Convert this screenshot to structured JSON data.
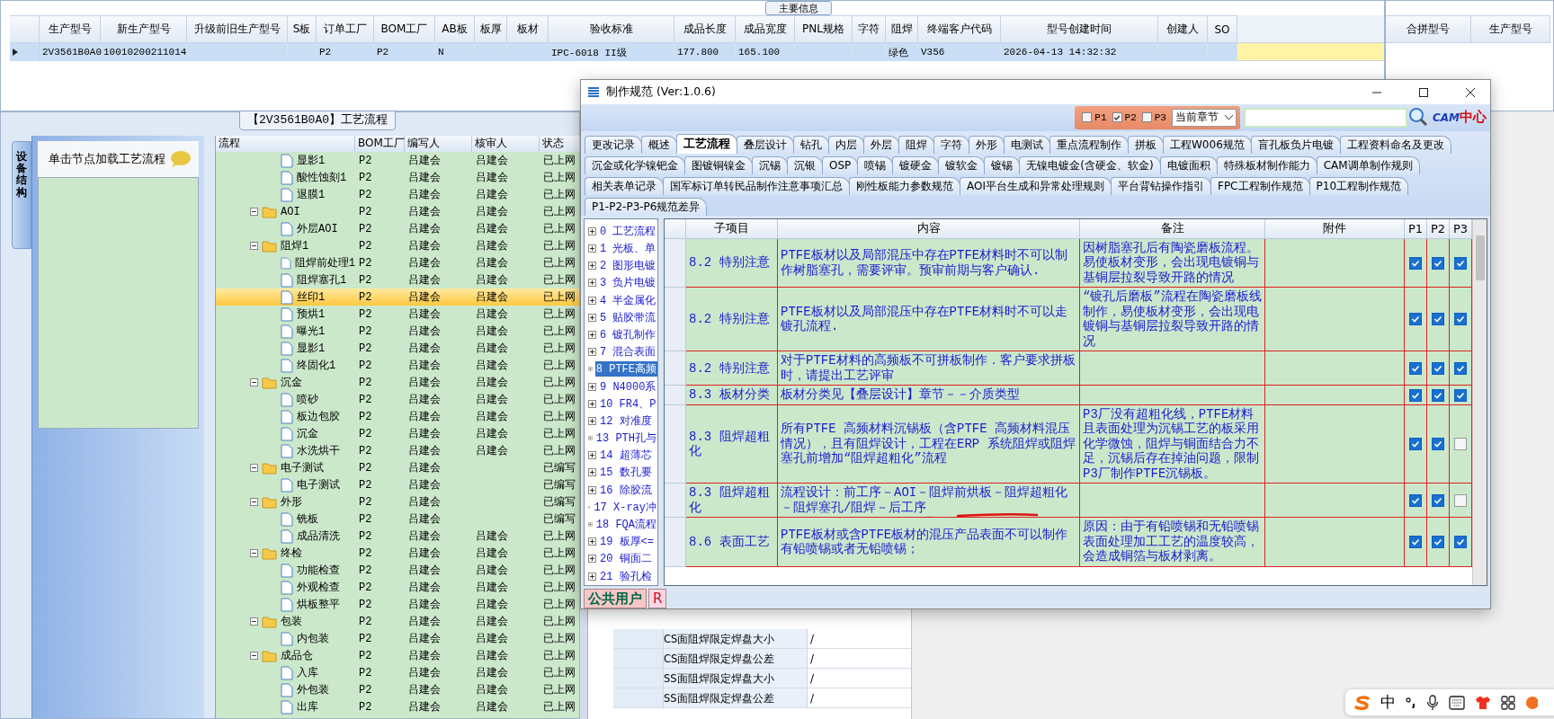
{
  "main_info": {
    "title": "主要信息",
    "row": {
      "selected": true
    },
    "columns": [
      {
        "label": "生产型号",
        "cell": "2V3561B0A0"
      },
      {
        "label": "新生产型号",
        "cell": "10010200211014"
      },
      {
        "label": "升级前旧生产型号"
      },
      {
        "label": "S板"
      },
      {
        "label": "订单工厂",
        "cell": "P2"
      },
      {
        "label": "BOM工厂",
        "cell": "P2"
      },
      {
        "label": "AB板",
        "cell": "N"
      },
      {
        "label": "板厚"
      },
      {
        "label": "板材"
      },
      {
        "label": "验收标准",
        "cell": "IPC-6018 II级"
      },
      {
        "label": "成品长度",
        "cell": "177.800"
      },
      {
        "label": "成品宽度",
        "cell": "165.100"
      },
      {
        "label": "PNL规格"
      },
      {
        "label": "字符"
      },
      {
        "label": "阻焊",
        "cell": "绿色"
      },
      {
        "label": "终端客户代码",
        "cell": "V356"
      },
      {
        "label": "型号创建时间",
        "cell": "2026-04-13 14:32:32"
      },
      {
        "label": "创建人"
      },
      {
        "label": "SO"
      }
    ]
  },
  "merge_panel": {
    "columns": [
      "合拼型号",
      "生产型号"
    ]
  },
  "process_panel": {
    "title": "【2V3561B0A0】工艺流程",
    "side_tab": "设备结构",
    "hint": "单击节点加载工艺流程"
  },
  "process_tree": {
    "columns": [
      "流程",
      "BOM工厂",
      "编写人",
      "核审人",
      "状态"
    ],
    "items": [
      {
        "children": [
          {
            "kind": "file",
            "label": "显影1",
            "factory": "P2",
            "author": "吕建会",
            "reviewer": "吕建会",
            "status": "已上网",
            "selected": false
          },
          {
            "kind": "file",
            "label": "酸性蚀刻1",
            "factory": "P2",
            "author": "吕建会",
            "reviewer": "吕建会",
            "status": "已上网",
            "selected": false
          },
          {
            "kind": "file",
            "label": "退膜1",
            "factory": "P2",
            "author": "吕建会",
            "reviewer": "吕建会",
            "status": "已上网",
            "selected": false
          }
        ]
      },
      {
        "kind": "folder",
        "label": "AOI",
        "factory": "P2",
        "author": "吕建会",
        "reviewer": "吕建会",
        "status": "已上网",
        "selected": false,
        "expanded": true,
        "children": [
          {
            "kind": "file",
            "label": "外层AOI",
            "factory": "P2",
            "author": "吕建会",
            "reviewer": "吕建会",
            "status": "已上网",
            "selected": false
          }
        ]
      },
      {
        "kind": "folder",
        "label": "阻焊1",
        "factory": "P2",
        "author": "吕建会",
        "reviewer": "吕建会",
        "status": "已上网",
        "selected": false,
        "expanded": true,
        "children": [
          {
            "kind": "file",
            "label": "阻焊前处理1",
            "factory": "P2",
            "author": "吕建会",
            "reviewer": "吕建会",
            "status": "已上网",
            "selected": false
          },
          {
            "kind": "file",
            "label": "阻焊塞孔1",
            "factory": "P2",
            "author": "吕建会",
            "reviewer": "吕建会",
            "status": "已上网",
            "selected": false
          },
          {
            "kind": "file",
            "label": "丝印1",
            "factory": "P2",
            "author": "吕建会",
            "reviewer": "吕建会",
            "status": "已上网",
            "selected": true
          },
          {
            "kind": "file",
            "label": "预烘1",
            "factory": "P2",
            "author": "吕建会",
            "reviewer": "吕建会",
            "status": "已上网",
            "selected": false
          },
          {
            "kind": "file",
            "label": "曝光1",
            "factory": "P2",
            "author": "吕建会",
            "reviewer": "吕建会",
            "status": "已上网",
            "selected": false
          },
          {
            "kind": "file",
            "label": "显影1",
            "factory": "P2",
            "author": "吕建会",
            "reviewer": "吕建会",
            "status": "已上网",
            "selected": false
          },
          {
            "kind": "file",
            "label": "终固化1",
            "factory": "P2",
            "author": "吕建会",
            "reviewer": "吕建会",
            "status": "已上网",
            "selected": false
          }
        ]
      },
      {
        "kind": "folder",
        "label": "沉金",
        "factory": "P2",
        "author": "吕建会",
        "reviewer": "吕建会",
        "status": "已上网",
        "selected": false,
        "expanded": true,
        "children": [
          {
            "kind": "file",
            "label": "喷砂",
            "factory": "P2",
            "author": "吕建会",
            "reviewer": "吕建会",
            "status": "已上网",
            "selected": false
          },
          {
            "kind": "file",
            "label": "板边包胶",
            "factory": "P2",
            "author": "吕建会",
            "reviewer": "吕建会",
            "status": "已上网",
            "selected": false
          },
          {
            "kind": "file",
            "label": "沉金",
            "factory": "P2",
            "author": "吕建会",
            "reviewer": "吕建会",
            "status": "已上网",
            "selected": false
          },
          {
            "kind": "file",
            "label": "水洗烘干",
            "factory": "P2",
            "author": "吕建会",
            "reviewer": "吕建会",
            "status": "已上网",
            "selected": false
          }
        ]
      },
      {
        "kind": "folder",
        "label": "电子测试",
        "factory": "P2",
        "author": "吕建会",
        "status": "已编写",
        "selected": false,
        "expanded": true,
        "children": [
          {
            "kind": "file",
            "label": "电子测试",
            "factory": "P2",
            "author": "吕建会",
            "status": "已编写",
            "selected": false
          }
        ]
      },
      {
        "kind": "folder",
        "label": "外形",
        "factory": "P2",
        "author": "吕建会",
        "status": "已编写",
        "selected": false,
        "expanded": true,
        "children": [
          {
            "kind": "file",
            "label": "铣板",
            "factory": "P2",
            "author": "吕建会",
            "status": "已编写",
            "selected": false
          },
          {
            "kind": "file",
            "label": "成品清洗",
            "factory": "P2",
            "author": "吕建会",
            "reviewer": "吕建会",
            "status": "已上网",
            "selected": false
          }
        ]
      },
      {
        "kind": "folder",
        "label": "终检",
        "factory": "P2",
        "author": "吕建会",
        "reviewer": "吕建会",
        "status": "已上网",
        "selected": false,
        "expanded": true,
        "children": [
          {
            "kind": "file",
            "label": "功能检查",
            "factory": "P2",
            "author": "吕建会",
            "reviewer": "吕建会",
            "status": "已上网",
            "selected": false
          },
          {
            "kind": "file",
            "label": "外观检查",
            "factory": "P2",
            "author": "吕建会",
            "reviewer": "吕建会",
            "status": "已上网",
            "selected": false
          },
          {
            "kind": "file",
            "label": "烘板整平",
            "factory": "P2",
            "author": "吕建会",
            "reviewer": "吕建会",
            "status": "已上网",
            "selected": false
          }
        ]
      },
      {
        "kind": "folder",
        "label": "包装",
        "factory": "P2",
        "author": "吕建会",
        "reviewer": "吕建会",
        "status": "已上网",
        "selected": false,
        "expanded": true,
        "children": [
          {
            "kind": "file",
            "label": "内包装",
            "factory": "P2",
            "author": "吕建会",
            "reviewer": "吕建会",
            "status": "已上网",
            "selected": false
          }
        ]
      },
      {
        "kind": "folder",
        "label": "成品仓",
        "factory": "P2",
        "author": "吕建会",
        "reviewer": "吕建会",
        "status": "已上网",
        "selected": false,
        "expanded": true,
        "children": [
          {
            "kind": "file",
            "label": "入库",
            "factory": "P2",
            "author": "吕建会",
            "reviewer": "吕建会",
            "status": "已上网",
            "selected": false
          },
          {
            "kind": "file",
            "label": "外包装",
            "factory": "P2",
            "author": "吕建会",
            "reviewer": "吕建会",
            "status": "已上网",
            "selected": false
          },
          {
            "kind": "file",
            "label": "出库",
            "factory": "P2",
            "author": "吕建会",
            "reviewer": "吕建会",
            "status": "已上网",
            "selected": false
          }
        ]
      }
    ]
  },
  "pad_params": [
    {
      "label": "CS面阻焊限定焊盘大小",
      "value": "/"
    },
    {
      "label": "CS面阻焊限定焊盘公差",
      "value": "/"
    },
    {
      "label": "SS面阻焊限定焊盘大小",
      "value": "/"
    },
    {
      "label": "SS面阻焊限定焊盘公差",
      "value": "/"
    }
  ],
  "dialog": {
    "title": "制作规范 (Ver:1.0.6)",
    "filters": [
      {
        "label": "P1",
        "checked": false
      },
      {
        "label": "P2",
        "checked": true
      },
      {
        "label": "P3",
        "checked": false
      }
    ],
    "scope": "当前章节",
    "logo": {
      "latin": "CAM",
      "chinese": "中心"
    },
    "tab_rows": [
      [
        {
          "label": "更改记录",
          "selected": false
        },
        {
          "label": "概述",
          "selected": false
        },
        {
          "label": "工艺流程",
          "selected": true
        },
        {
          "label": "叠层设计",
          "selected": false
        },
        {
          "label": "钻孔",
          "selected": false
        },
        {
          "label": "内层",
          "selected": false
        },
        {
          "label": "外层",
          "selected": false
        },
        {
          "label": "阻焊",
          "selected": false
        },
        {
          "label": "字符",
          "selected": false
        },
        {
          "label": "外形",
          "selected": false
        },
        {
          "label": "电测试",
          "selected": false
        },
        {
          "label": "重点流程制作",
          "selected": false
        },
        {
          "label": "拼板",
          "selected": false
        },
        {
          "label": "工程W006规范",
          "selected": false
        },
        {
          "label": "盲孔板负片电镀",
          "selected": false
        },
        {
          "label": "工程资料命名及更改",
          "selected": false
        }
      ],
      [
        {
          "label": "沉金或化学镍钯金",
          "selected": false
        },
        {
          "label": "图镀铜镍金",
          "selected": false
        },
        {
          "label": "沉锡",
          "selected": false
        },
        {
          "label": "沉银",
          "selected": false
        },
        {
          "label": "OSP",
          "selected": false
        },
        {
          "label": "喷锡",
          "selected": false
        },
        {
          "label": "镀硬金",
          "selected": false
        },
        {
          "label": "镀软金",
          "selected": false
        },
        {
          "label": "镀锡",
          "selected": false
        },
        {
          "label": "无镍电镀金(含硬金、软金)",
          "selected": false
        },
        {
          "label": "电镀面积",
          "selected": false
        },
        {
          "label": "特殊板材制作能力",
          "selected": false
        },
        {
          "label": "CAM调单制作规则",
          "selected": false
        }
      ],
      [
        {
          "label": "相关表单记录",
          "selected": false
        },
        {
          "label": "国军标订单转民品制作注意事项汇总",
          "selected": false
        },
        {
          "label": "刚性板能力参数规范",
          "selected": false
        },
        {
          "label": "AOI平台生成和异常处理规则",
          "selected": false
        },
        {
          "label": "平台背钻操作指引",
          "selected": false
        },
        {
          "label": "FPC工程制作规范",
          "selected": false
        },
        {
          "label": "P10工程制作规范",
          "selected": false
        }
      ],
      [
        {
          "label": "P1-P2-P3-P6规范差异",
          "selected": false
        }
      ]
    ],
    "chapters": [
      {
        "label": "0 工艺流程",
        "selected": false
      },
      {
        "label": "1 光板、单",
        "selected": false
      },
      {
        "label": "2 图形电镀",
        "selected": false
      },
      {
        "label": "3 负片电镀",
        "selected": false
      },
      {
        "label": "4 半金属化",
        "selected": false
      },
      {
        "label": "5 贴胶带流",
        "selected": false
      },
      {
        "label": "6 镀孔制作",
        "selected": false
      },
      {
        "label": "7 混合表面",
        "selected": false
      },
      {
        "label": "8 PTFE高频",
        "selected": true
      },
      {
        "label": "9 N4000系",
        "selected": false
      },
      {
        "label": "10 FR4、P",
        "selected": false
      },
      {
        "label": "12 对准度",
        "selected": false
      },
      {
        "label": "13 PTH孔与",
        "selected": false
      },
      {
        "label": "14 超薄芯",
        "selected": false
      },
      {
        "label": "15 数孔要",
        "selected": false
      },
      {
        "label": "16 除胶流",
        "selected": false
      },
      {
        "label": "17 X-ray冲",
        "selected": false
      },
      {
        "label": "18 FQA流程",
        "selected": false
      },
      {
        "label": "19 板厚<=",
        "selected": false
      },
      {
        "label": "20 铜面二",
        "selected": false
      },
      {
        "label": "21 验孔检",
        "selected": false
      }
    ],
    "columns": [
      "子项目",
      "内容",
      "备注",
      "附件",
      "P1",
      "P2",
      "P3"
    ],
    "rules": [
      {
        "item": "8.2 特别注意",
        "content": "PTFE板材以及局部混压中存在PTFE材料时不可以制作树脂塞孔，需要评审。预审前期与客户确认.",
        "note": "因树脂塞孔后有陶瓷磨板流程。易使板材变形，会出现电镀铜与基铜层拉裂导致开路的情况",
        "p1": true,
        "p2": true,
        "p3": true
      },
      {
        "item": "8.2 特别注意",
        "content": "PTFE板材以及局部混压中存在PTFE材料时不可以走镀孔流程.",
        "note": "“镀孔后磨板”流程在陶瓷磨板线制作，易使板材变形，会出现电镀铜与基铜层拉裂导致开路的情况",
        "p1": true,
        "p2": true,
        "p3": true
      },
      {
        "item": "8.2 特别注意",
        "content": "对于PTFE材料的高频板不可拼板制作．客户要求拼板时，请提出工艺评审",
        "p1": true,
        "p2": true,
        "p3": true
      },
      {
        "item": "8.3 板材分类",
        "content": "板材分类见【叠层设计】章节－－介质类型",
        "p1": true,
        "p2": true,
        "p3": true
      },
      {
        "item": "8.3 阻焊超粗化",
        "content": "所有PTFE 高频材料沉锡板（含PTFE 高频材料混压情况），且有阻焊设计，工程在ERP 系统阻焊或阻焊塞孔前增加“阻焊超粗化”流程",
        "note": "P3厂没有超粗化线，PTFE材料且表面处理为沉锡工艺的板采用化学微蚀，阻焊与铜面结合力不足，沉锡后存在掉油问题，限制P3厂制作PTFE沉锡板。",
        "p1": true,
        "p2": true,
        "p3": false
      },
      {
        "item": "8.3 阻焊超粗化",
        "content": "流程设计：前工序－AOI－阻焊前烘板－阻焊超粗化－阻焊塞孔/阻焊－后工序",
        "p1": true,
        "p2": true,
        "p3": false,
        "underlined": true
      },
      {
        "item": "8.6 表面工艺",
        "content": "PTFE板材或含PTFE板材的混压产品表面不可以制作有铅喷锡或者无铅喷锡；",
        "note": "原因：由于有铅喷锡和无铅喷锡表面处理加工工艺的温度较高，会造成铜箔与板材剥离。",
        "p1": true,
        "p2": true,
        "p3": true
      }
    ],
    "user_tab": "公共用户",
    "user_flag": "R"
  },
  "ime_bar": {
    "mode": "中"
  }
}
